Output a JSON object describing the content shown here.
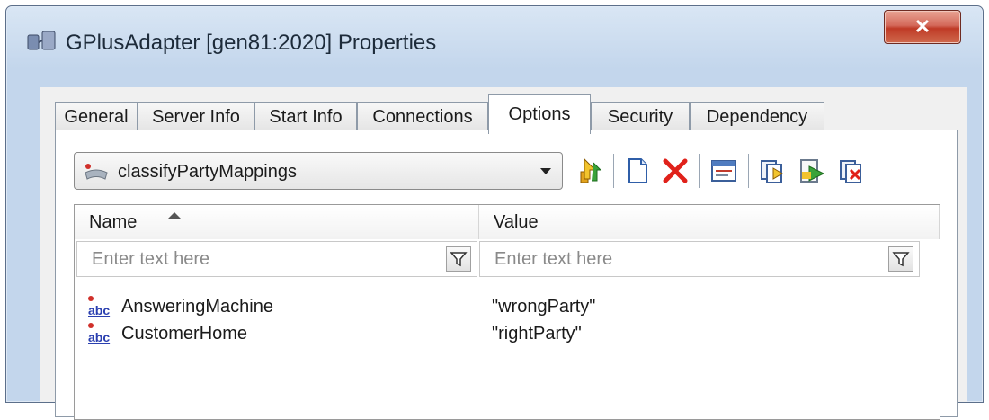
{
  "window": {
    "title": "GPlusAdapter [gen81:2020] Properties",
    "close_glyph": "✕"
  },
  "tabs": [
    {
      "label": "General"
    },
    {
      "label": "Server Info"
    },
    {
      "label": "Start Info"
    },
    {
      "label": "Connections"
    },
    {
      "label": "Options",
      "active": true
    },
    {
      "label": "Security"
    },
    {
      "label": "Dependency"
    }
  ],
  "section_select": {
    "value": "classifyPartyMappings",
    "icon": "section-icon"
  },
  "toolbar": {
    "buttons": [
      {
        "icon": "import-icon"
      },
      {
        "icon": "new-icon"
      },
      {
        "icon": "delete-icon"
      },
      {
        "icon": "properties-icon"
      },
      {
        "icon": "copy-icon"
      },
      {
        "icon": "export-icon"
      },
      {
        "icon": "remove-section-icon"
      }
    ]
  },
  "grid": {
    "columns": [
      {
        "label": "Name",
        "sorted": "ascending"
      },
      {
        "label": "Value"
      }
    ],
    "filter_placeholder_name": "Enter text here",
    "filter_placeholder_value": "Enter text here",
    "rows": [
      {
        "type_icon": "abc",
        "name": "AnsweringMachine",
        "value": "\"wrongParty\""
      },
      {
        "type_icon": "abc",
        "name": "CustomerHome",
        "value": "\"rightParty\""
      }
    ]
  },
  "colors": {
    "title_bar": "#c3d6ec",
    "close_button": "#c8442f",
    "delete_red": "#e0211a",
    "string_icon_blue": "#2a3fb0"
  }
}
